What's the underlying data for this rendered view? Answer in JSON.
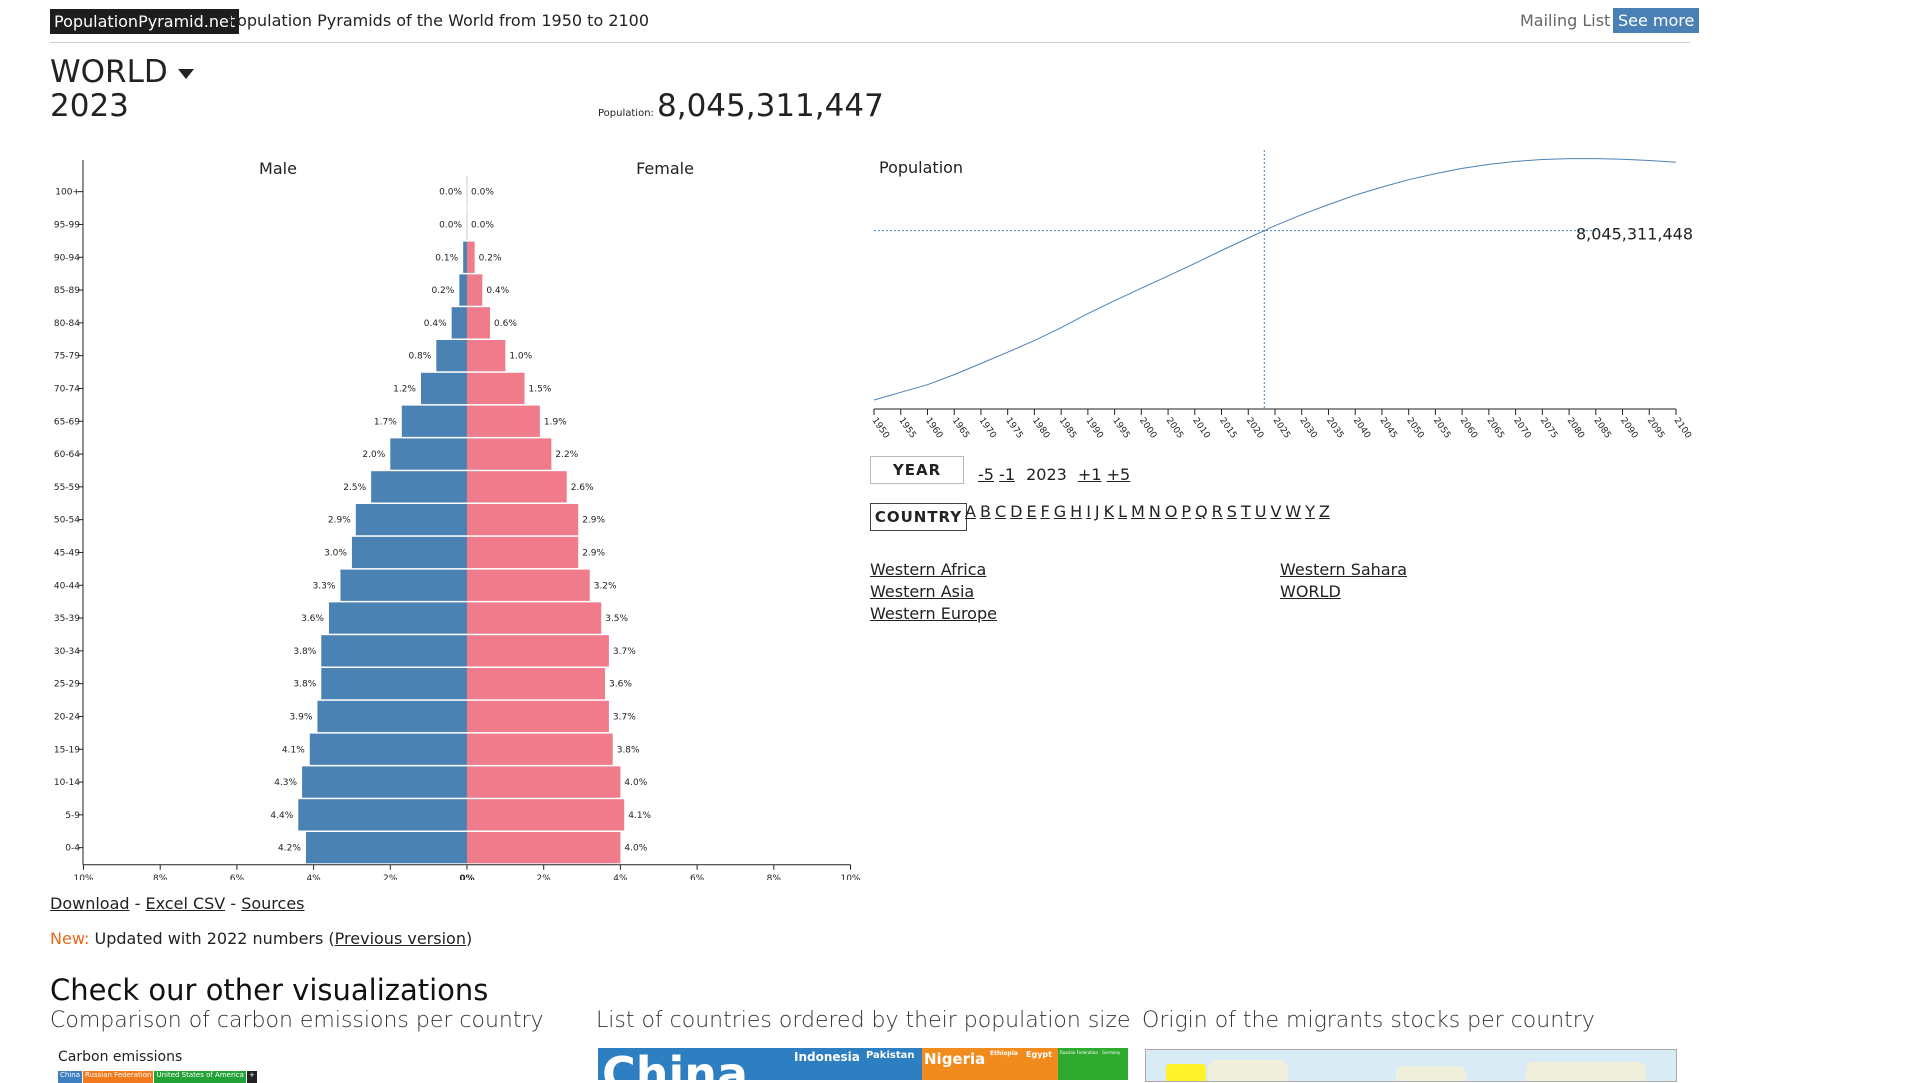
{
  "header": {
    "brand": "PopulationPyramid.net",
    "tagline": "Population Pyramids of the World from 1950 to 2100",
    "mailing_list": "Mailing List -",
    "see_more": "See more"
  },
  "location": {
    "name": "WORLD",
    "year": "2023"
  },
  "population": {
    "label": "Population:",
    "value": "8,045,311,447"
  },
  "pyramid": {
    "male_label": "Male",
    "female_label": "Female",
    "age_groups": [
      "100+",
      "95-99",
      "90-94",
      "85-89",
      "80-84",
      "75-79",
      "70-74",
      "65-69",
      "60-64",
      "55-59",
      "50-54",
      "45-49",
      "40-44",
      "35-39",
      "30-34",
      "25-29",
      "20-24",
      "15-19",
      "10-14",
      "5-9",
      "0-4"
    ],
    "male_values": [
      0.0,
      0.0,
      0.1,
      0.2,
      0.4,
      0.8,
      1.2,
      1.7,
      2.0,
      2.5,
      2.9,
      3.0,
      3.3,
      3.6,
      3.8,
      3.8,
      3.9,
      4.1,
      4.3,
      4.4,
      4.2
    ],
    "female_values": [
      0.0,
      0.0,
      0.2,
      0.4,
      0.6,
      1.0,
      1.5,
      1.9,
      2.2,
      2.6,
      2.9,
      2.9,
      3.2,
      3.5,
      3.7,
      3.6,
      3.7,
      3.8,
      4.0,
      4.1,
      4.0
    ],
    "male_labels": [
      "0.0%",
      "0.0%",
      "0.1%",
      "0.2%",
      "0.4%",
      "0.8%",
      "1.2%",
      "1.7%",
      "2.0%",
      "2.5%",
      "2.9%",
      "3.0%",
      "3.3%",
      "3.6%",
      "3.8%",
      "3.8%",
      "3.9%",
      "4.1%",
      "4.3%",
      "4.4%",
      "4.2%"
    ],
    "female_labels": [
      "0.0%",
      "0.0%",
      "0.2%",
      "0.4%",
      "0.6%",
      "1.0%",
      "1.5%",
      "1.9%",
      "2.2%",
      "2.6%",
      "2.9%",
      "2.9%",
      "3.2%",
      "3.5%",
      "3.7%",
      "3.6%",
      "3.7%",
      "3.8%",
      "4.0%",
      "4.1%",
      "4.0%"
    ],
    "x_ticks": [
      "10%",
      "8%",
      "6%",
      "4%",
      "2%",
      "0%",
      "2%",
      "4%",
      "6%",
      "8%",
      "10%"
    ],
    "male_color": "#4a82b4",
    "female_color": "#ef7b8b"
  },
  "chart_data": {
    "type": "line",
    "title": "Population",
    "x": [
      1950,
      1955,
      1960,
      1965,
      1970,
      1975,
      1980,
      1985,
      1990,
      1995,
      2000,
      2005,
      2010,
      2015,
      2020,
      2025,
      2030,
      2035,
      2040,
      2045,
      2050,
      2055,
      2060,
      2065,
      2070,
      2075,
      2080,
      2085,
      2090,
      2095,
      2100
    ],
    "x_tick_labels": [
      "1950",
      "1955",
      "1960",
      "1965",
      "1970",
      "1975",
      "1980",
      "1985",
      "1990",
      "1995",
      "2000",
      "2005",
      "2010",
      "2015",
      "2020",
      "2025",
      "2030",
      "2035",
      "2040",
      "2045",
      "2050",
      "2055",
      "2060",
      "2065",
      "2070",
      "2075",
      "2080",
      "2085",
      "2090",
      "2095",
      "2100"
    ],
    "series": [
      {
        "values": [
          2.5,
          2.75,
          3.0,
          3.33,
          3.69,
          4.06,
          4.44,
          4.86,
          5.32,
          5.74,
          6.15,
          6.55,
          6.96,
          7.38,
          7.79,
          8.19,
          8.55,
          8.88,
          9.19,
          9.45,
          9.69,
          9.89,
          10.06,
          10.19,
          10.29,
          10.35,
          10.38,
          10.38,
          10.36,
          10.32,
          10.26
        ]
      }
    ],
    "highlight_year": 2023,
    "highlight_label": "8,045,311,448",
    "line_color": "#4a82b4",
    "ylim": [
      2.5,
      10.4
    ]
  },
  "controls": {
    "year_label": "YEAR",
    "minus5": "-5",
    "minus1": "-1",
    "current_year": "2023",
    "plus1": "+1",
    "plus5": "+5",
    "country_label": "COUNTRY",
    "letters": [
      "A",
      "B",
      "C",
      "D",
      "E",
      "F",
      "G",
      "H",
      "I",
      "J",
      "K",
      "L",
      "M",
      "N",
      "O",
      "P",
      "Q",
      "R",
      "S",
      "T",
      "U",
      "V",
      "W",
      "Y",
      "Z"
    ]
  },
  "regions": {
    "col1": [
      "Western Africa",
      "Western Asia",
      "Western Europe"
    ],
    "col2": [
      "Western Sahara",
      "WORLD"
    ]
  },
  "footer": {
    "download": "Download",
    "excel": "Excel CSV",
    "sources": "Sources",
    "sep": "-",
    "new_label": "New:",
    "updated_text": "Updated with 2022 numbers (",
    "previous_version": "Previous version",
    "close_paren": ")",
    "check_title": "Check our other visualizations",
    "viz1_title": "Comparison of carbon emissions per country",
    "viz1_chart_title": "Carbon emissions",
    "viz1_legend": [
      "China",
      "Russian Federation",
      "United States of America",
      "+"
    ],
    "viz2_title": "List of countries ordered by their population size",
    "viz2_items": [
      "China",
      "Indonesia",
      "Pakistan",
      "Nigeria",
      "Ethiopia",
      "Egypt",
      "Russian Federation",
      "Germany"
    ],
    "viz3_title": "Origin of the migrants stocks per country"
  }
}
